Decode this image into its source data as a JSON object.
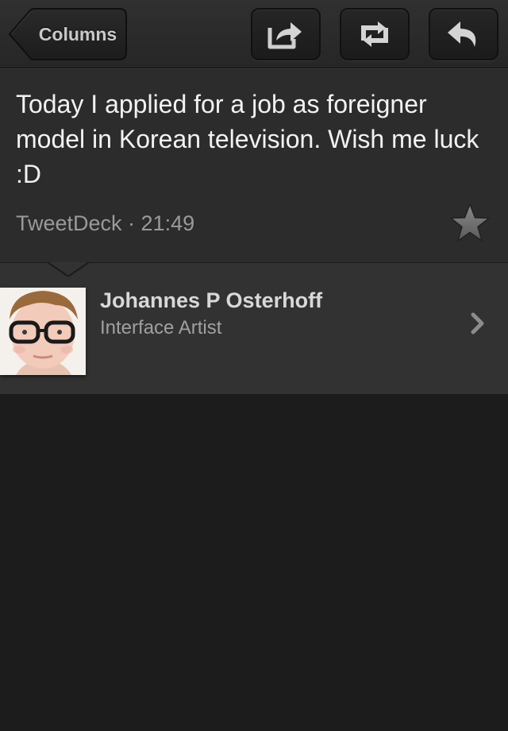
{
  "toolbar": {
    "back_label": "Columns",
    "buttons": [
      {
        "name": "share-button",
        "icon": "share-icon"
      },
      {
        "name": "retweet-button",
        "icon": "retweet-icon"
      },
      {
        "name": "reply-button",
        "icon": "reply-icon"
      }
    ]
  },
  "tweet": {
    "text": "Today I applied for a job as foreigner model in Korean television. Wish me luck :D",
    "meta": "TweetDeck · 21:49",
    "favorite_icon": "star-icon"
  },
  "author": {
    "name": "Johannes P Osterhoff",
    "title": "Interface Artist",
    "avatar_icon": "avatar-photo",
    "disclosure_icon": "chevron-right-icon"
  },
  "colors": {
    "background": "#1c1c1c",
    "tweet_panel": "#2c2c2c",
    "author_panel": "#323232",
    "text_primary": "#f2f2f2",
    "text_secondary": "#9a9a9a"
  }
}
